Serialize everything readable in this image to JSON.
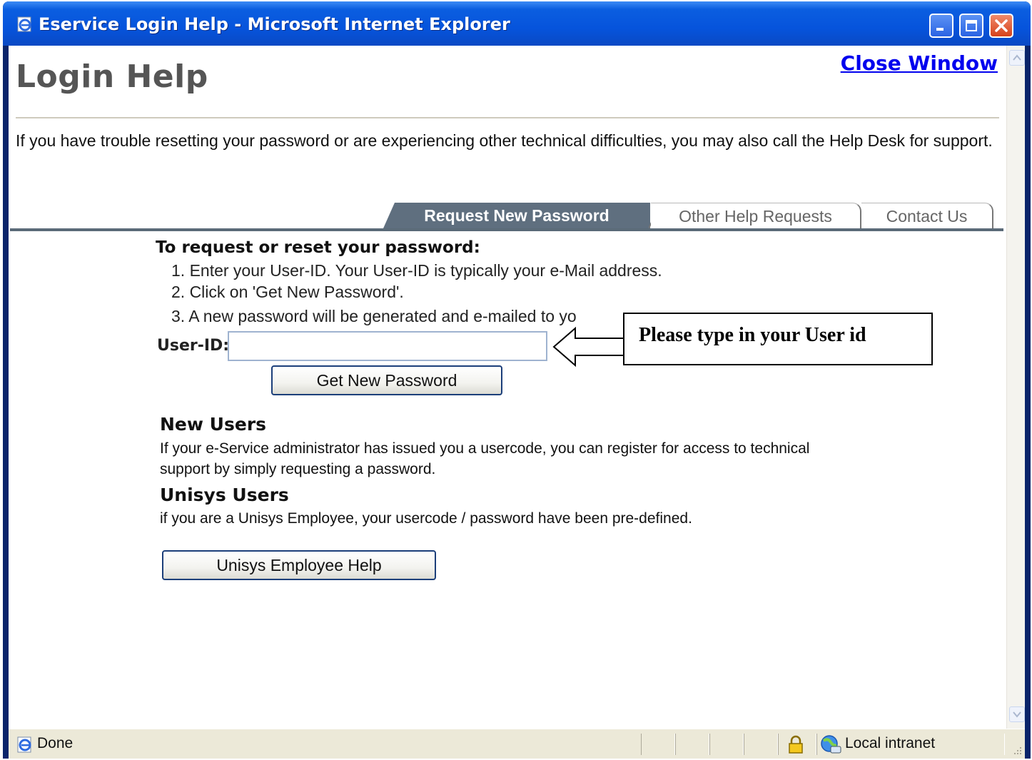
{
  "window": {
    "title": "Eservice Login Help - Microsoft Internet Explorer"
  },
  "page": {
    "title": "Login Help",
    "close_link": "Close Window",
    "intro": "If you have trouble resetting your password or are experiencing other technical difficulties, you may also call the Help Desk for support."
  },
  "tabs": [
    {
      "label": "Request New Password",
      "active": true
    },
    {
      "label": "Other Help Requests",
      "active": false
    },
    {
      "label": "Contact Us",
      "active": false
    }
  ],
  "request": {
    "heading": "To request or reset your password:",
    "steps": [
      "1. Enter your User-ID. Your User-ID is typically your e-Mail address.",
      "2. Click on 'Get New Password'.",
      "3. A new password will be generated and e-mailed to yo"
    ],
    "user_id_label": "User-ID:",
    "user_id_value": "",
    "button_label": "Get New Password"
  },
  "callout": {
    "text": "Please type in your User id"
  },
  "new_users": {
    "title": "New Users",
    "body": "If your e-Service administrator has issued you a usercode, you can register for access to technical support by simply requesting a password."
  },
  "unisys_users": {
    "title": "Unisys Users",
    "body": "if you are a Unisys Employee, your usercode / password have been pre-defined.",
    "button_label": "Unisys Employee Help"
  },
  "statusbar": {
    "status": "Done",
    "zone": "Local intranet"
  },
  "icons": [
    "ie-page-icon",
    "minimize-icon",
    "maximize-icon",
    "close-icon",
    "lock-icon",
    "local-intranet-icon",
    "scroll-up-icon",
    "scroll-down-icon",
    "resize-grip-icon"
  ]
}
